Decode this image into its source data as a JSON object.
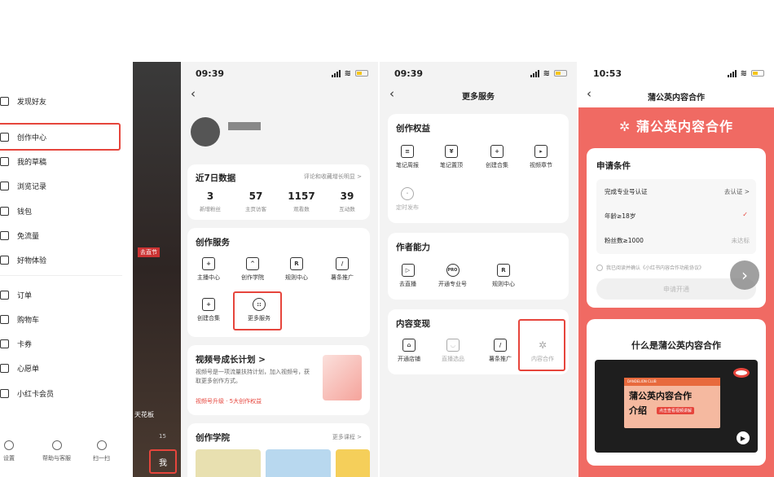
{
  "panel1": {
    "menu": [
      {
        "label": "发现好友",
        "icon": "add-friend-icon"
      },
      {
        "label": "创作中心",
        "icon": "creator-icon"
      },
      {
        "label": "我的草稿",
        "icon": "draft-icon"
      },
      {
        "label": "浏览记录",
        "icon": "history-icon"
      },
      {
        "label": "钱包",
        "icon": "wallet-icon"
      },
      {
        "label": "免流量",
        "icon": "data-icon"
      },
      {
        "label": "好物体验",
        "icon": "gift-icon"
      },
      {
        "label": "订单",
        "icon": "order-icon"
      },
      {
        "label": "购物车",
        "icon": "cart-icon"
      },
      {
        "label": "卡券",
        "icon": "coupon-icon"
      },
      {
        "label": "心愿单",
        "icon": "wishlist-icon"
      },
      {
        "label": "小红卡会员",
        "icon": "member-icon"
      }
    ],
    "bottom": [
      "设置",
      "帮助与客服",
      "扫一扫"
    ],
    "bg_text": [
      "去直节",
      "天花板",
      "15"
    ],
    "me_tab": "我"
  },
  "panel2": {
    "time": "09:39",
    "stats_title": "近7日数据",
    "stats_link": "评论和收藏增长明显 >",
    "stats": [
      {
        "value": "3",
        "label": "新增粉丝"
      },
      {
        "value": "57",
        "label": "主页访客"
      },
      {
        "value": "1157",
        "label": "观看数"
      },
      {
        "value": "39",
        "label": "互动数"
      }
    ],
    "services_title": "创作服务",
    "services": [
      "主播中心",
      "创作学院",
      "规则中心",
      "薯条推广",
      "创建合集",
      "更多服务"
    ],
    "promo_title": "视频号成长计划 >",
    "promo_desc": "视频号是一项流量扶持计划，加入视频号，获取更多创作方式。",
    "promo_link": "视频号升级 · 5大创作权益",
    "academy_title": "创作学院",
    "academy_link": "更多课程 >"
  },
  "panel3": {
    "time": "09:39",
    "title": "更多服务",
    "sections": [
      {
        "title": "创作权益",
        "items": [
          "笔记周报",
          "笔记置顶",
          "创建合集",
          "视频章节",
          "定时发布"
        ]
      },
      {
        "title": "作者能力",
        "items": [
          "去直播",
          "开通专业号",
          "规则中心"
        ]
      },
      {
        "title": "内容变现",
        "items": [
          "开通店铺",
          "直播选品",
          "薯条推广",
          "内容合作"
        ]
      }
    ]
  },
  "panel4": {
    "time": "10:53",
    "title": "蒲公英内容合作",
    "brand": "蒲公英内容合作",
    "req_title": "申请条件",
    "requirements": [
      {
        "label": "完成专业号认证",
        "status": "去认证 >"
      },
      {
        "label": "年龄≥18岁",
        "status": "✓"
      },
      {
        "label": "粉丝数≥1000",
        "status": "未达标"
      }
    ],
    "agree": "我已阅读并确认《小红书内容合作功能协议》",
    "apply_btn": "申请开通",
    "what_title": "什么是蒲公英内容合作",
    "video_title": "蒲公英内容合作",
    "video_sub": "介绍",
    "video_tag": "点击查看视频讲解",
    "club": "DANDELION CLUB"
  },
  "colors": {
    "accent": "#e6453c",
    "brand_red": "#f06a63"
  }
}
